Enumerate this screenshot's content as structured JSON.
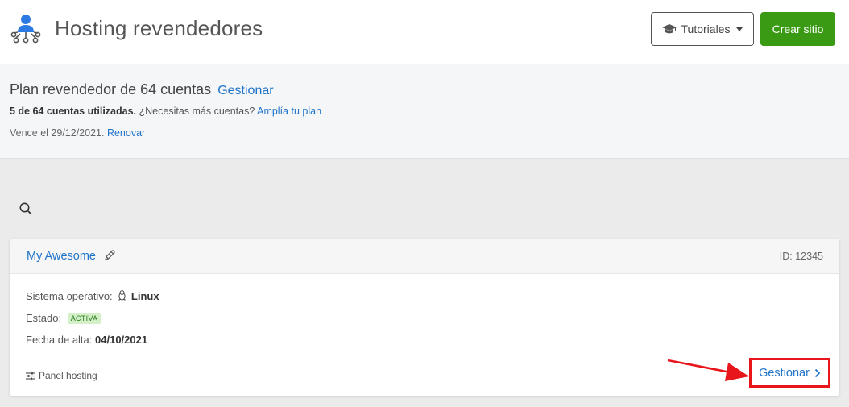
{
  "header": {
    "title": "Hosting revendedores",
    "tutorials_label": "Tutoriales",
    "create_label": "Crear sitio"
  },
  "plan": {
    "title": "Plan revendedor de 64 cuentas",
    "manage_link": "Gestionar",
    "usage_bold": "5 de 64 cuentas utilizadas.",
    "usage_question": "¿Necesitas más cuentas?",
    "expand_link": "Amplía tu plan",
    "expiry_text": "Vence el 29/12/2021.",
    "renew_link": "Renovar"
  },
  "site": {
    "name": "My Awesome",
    "id_label": "ID: 12345",
    "os_label": "Sistema operativo:",
    "os_value": "Linux",
    "status_label": "Estado:",
    "status_value": "ACTIVA",
    "date_label": "Fecha de alta:",
    "date_value": "04/10/2021",
    "panel_label": "Panel hosting",
    "manage_label": "Gestionar"
  },
  "colors": {
    "accent": "#1f74c9",
    "create_button": "#3a9a13",
    "highlight": "#e8151b",
    "status_badge_bg": "#d3f0c8"
  },
  "icons": {
    "logo": "reseller-network-icon",
    "tutorials": "graduation-cap-icon",
    "search": "search-icon",
    "edit": "pencil-icon",
    "os": "tux-icon",
    "panel": "sliders-icon",
    "manage": "chevron-right-icon"
  }
}
